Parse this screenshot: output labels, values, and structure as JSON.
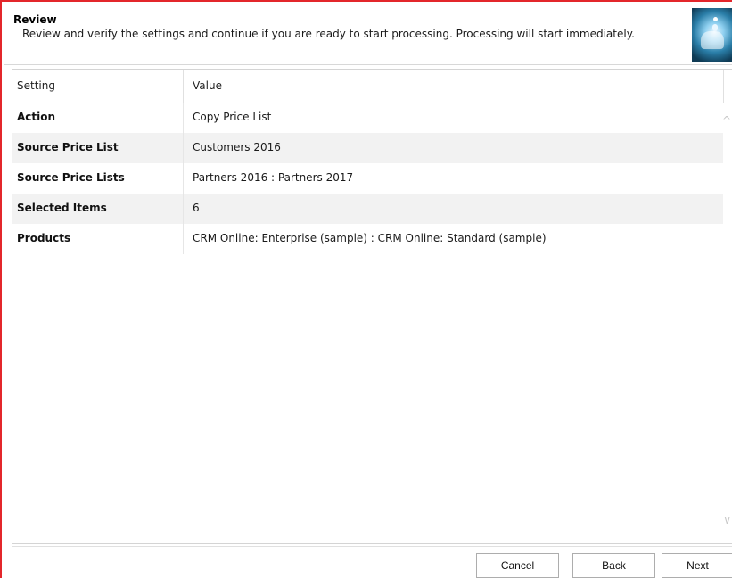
{
  "header": {
    "title": "Review",
    "description": "Review and verify the settings and continue if you are ready to start processing. Processing will start immediately."
  },
  "grid": {
    "columns": [
      "Setting",
      "Value"
    ],
    "rows": [
      {
        "setting": "Action",
        "value": "Copy Price List"
      },
      {
        "setting": "Source Price List",
        "value": "Customers 2016"
      },
      {
        "setting": "Source Price Lists",
        "value": "Partners 2016 : Partners 2017"
      },
      {
        "setting": "Selected Items",
        "value": "6"
      },
      {
        "setting": "Products",
        "value": "CRM Online: Enterprise (sample) : CRM Online: Standard (sample)"
      }
    ]
  },
  "scroll": {
    "up_glyph": "^",
    "down_glyph": "∨"
  },
  "buttons": {
    "cancel": "Cancel",
    "back": "Back",
    "next": "Next"
  },
  "colors": {
    "frame_border": "#e3262b",
    "alt_row": "#f2f2f2"
  }
}
